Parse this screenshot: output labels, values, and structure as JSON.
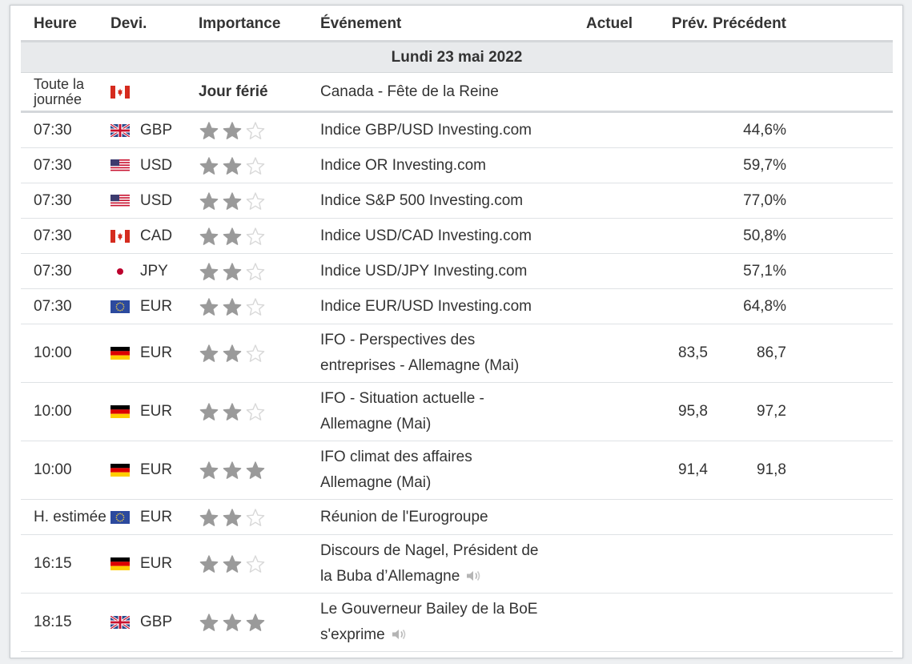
{
  "columns": {
    "time": "Heure",
    "currency": "Devi.",
    "importance": "Importance",
    "event": "Événement",
    "actual": "Actuel",
    "forecast": "Prév.",
    "previous": "Précédent"
  },
  "day_label": "Lundi 23 mai 2022",
  "colors": {
    "star_filled": "#9a9a9a",
    "star_empty": "#d8d8d8",
    "header_bg": "#e8eaec",
    "border": "#d4d7da"
  },
  "holiday": {
    "time": "Toute la journée",
    "flag": "CA",
    "importance": "Jour férié",
    "event": "Canada - Fête de la Reine"
  },
  "events": [
    {
      "time": "07:30",
      "flag": "GB",
      "currency": "GBP",
      "stars": 2,
      "event": "Indice GBP/USD Investing.com",
      "actual": "",
      "forecast": "",
      "previous": "44,6%",
      "speech": false
    },
    {
      "time": "07:30",
      "flag": "US",
      "currency": "USD",
      "stars": 2,
      "event": "Indice OR Investing.com",
      "actual": "",
      "forecast": "",
      "previous": "59,7%",
      "speech": false
    },
    {
      "time": "07:30",
      "flag": "US",
      "currency": "USD",
      "stars": 2,
      "event": "Indice S&P 500 Investing.com",
      "actual": "",
      "forecast": "",
      "previous": "77,0%",
      "speech": false
    },
    {
      "time": "07:30",
      "flag": "CA",
      "currency": "CAD",
      "stars": 2,
      "event": "Indice USD/CAD Investing.com",
      "actual": "",
      "forecast": "",
      "previous": "50,8%",
      "speech": false
    },
    {
      "time": "07:30",
      "flag": "JP",
      "currency": "JPY",
      "stars": 2,
      "event": "Indice USD/JPY Investing.com",
      "actual": "",
      "forecast": "",
      "previous": "57,1%",
      "speech": false
    },
    {
      "time": "07:30",
      "flag": "EU",
      "currency": "EUR",
      "stars": 2,
      "event": "Indice EUR/USD Investing.com",
      "actual": "",
      "forecast": "",
      "previous": "64,8%",
      "speech": false
    },
    {
      "time": "10:00",
      "flag": "DE",
      "currency": "EUR",
      "stars": 2,
      "event_lines": [
        "IFO - Perspectives des",
        "entreprises - Allemagne (Mai)"
      ],
      "actual": "",
      "forecast": "83,5",
      "previous": "86,7",
      "speech": false
    },
    {
      "time": "10:00",
      "flag": "DE",
      "currency": "EUR",
      "stars": 2,
      "event_lines": [
        "IFO - Situation actuelle -",
        "Allemagne (Mai)"
      ],
      "actual": "",
      "forecast": "95,8",
      "previous": "97,2",
      "speech": false
    },
    {
      "time": "10:00",
      "flag": "DE",
      "currency": "EUR",
      "stars": 3,
      "event_lines": [
        "IFO climat des affaires",
        "Allemagne (Mai)"
      ],
      "actual": "",
      "forecast": "91,4",
      "previous": "91,8",
      "speech": false
    },
    {
      "time": "H. estimée",
      "flag": "EU",
      "currency": "EUR",
      "stars": 2,
      "event": "Réunion de l'Eurogroupe",
      "actual": "",
      "forecast": "",
      "previous": "",
      "speech": false
    },
    {
      "time": "16:15",
      "flag": "DE",
      "currency": "EUR",
      "stars": 2,
      "event_lines": [
        "Discours de Nagel, Président de",
        "la Buba d’Allemagne"
      ],
      "actual": "",
      "forecast": "",
      "previous": "",
      "speech": true
    },
    {
      "time": "18:15",
      "flag": "GB",
      "currency": "GBP",
      "stars": 3,
      "event_lines": [
        "Le Gouverneur Bailey de la BoE",
        "s'exprime"
      ],
      "actual": "",
      "forecast": "",
      "previous": "",
      "speech": true
    }
  ]
}
